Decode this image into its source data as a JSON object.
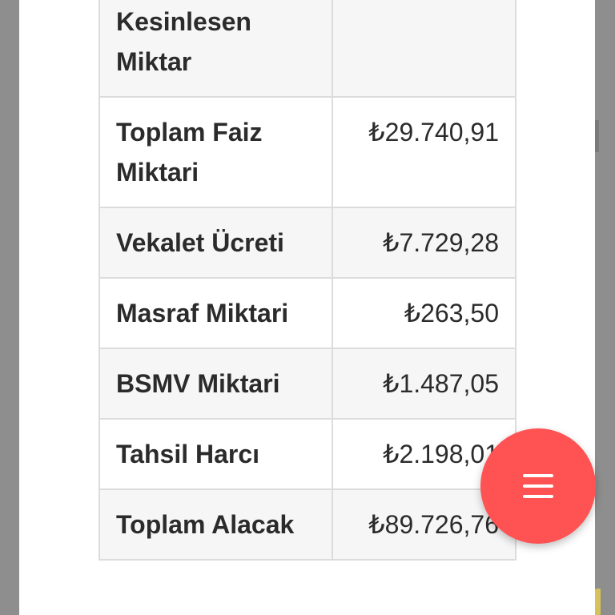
{
  "table": {
    "rows": [
      {
        "label": "Kesinlesen Miktar",
        "value": ""
      },
      {
        "label": "Toplam Faiz Miktari",
        "value": "₺29.740,91"
      },
      {
        "label": "Vekalet Ücreti",
        "value": "₺7.729,28"
      },
      {
        "label": "Masraf Miktari",
        "value": "₺263,50"
      },
      {
        "label": "BSMV Miktari",
        "value": "₺1.487,05"
      },
      {
        "label": "Tahsil Harcı",
        "value": "₺2.198,01"
      },
      {
        "label": "Toplam Alacak",
        "value": "₺89.726,76"
      }
    ]
  },
  "fab": {
    "icon": "menu-icon",
    "color": "#ff5252"
  }
}
